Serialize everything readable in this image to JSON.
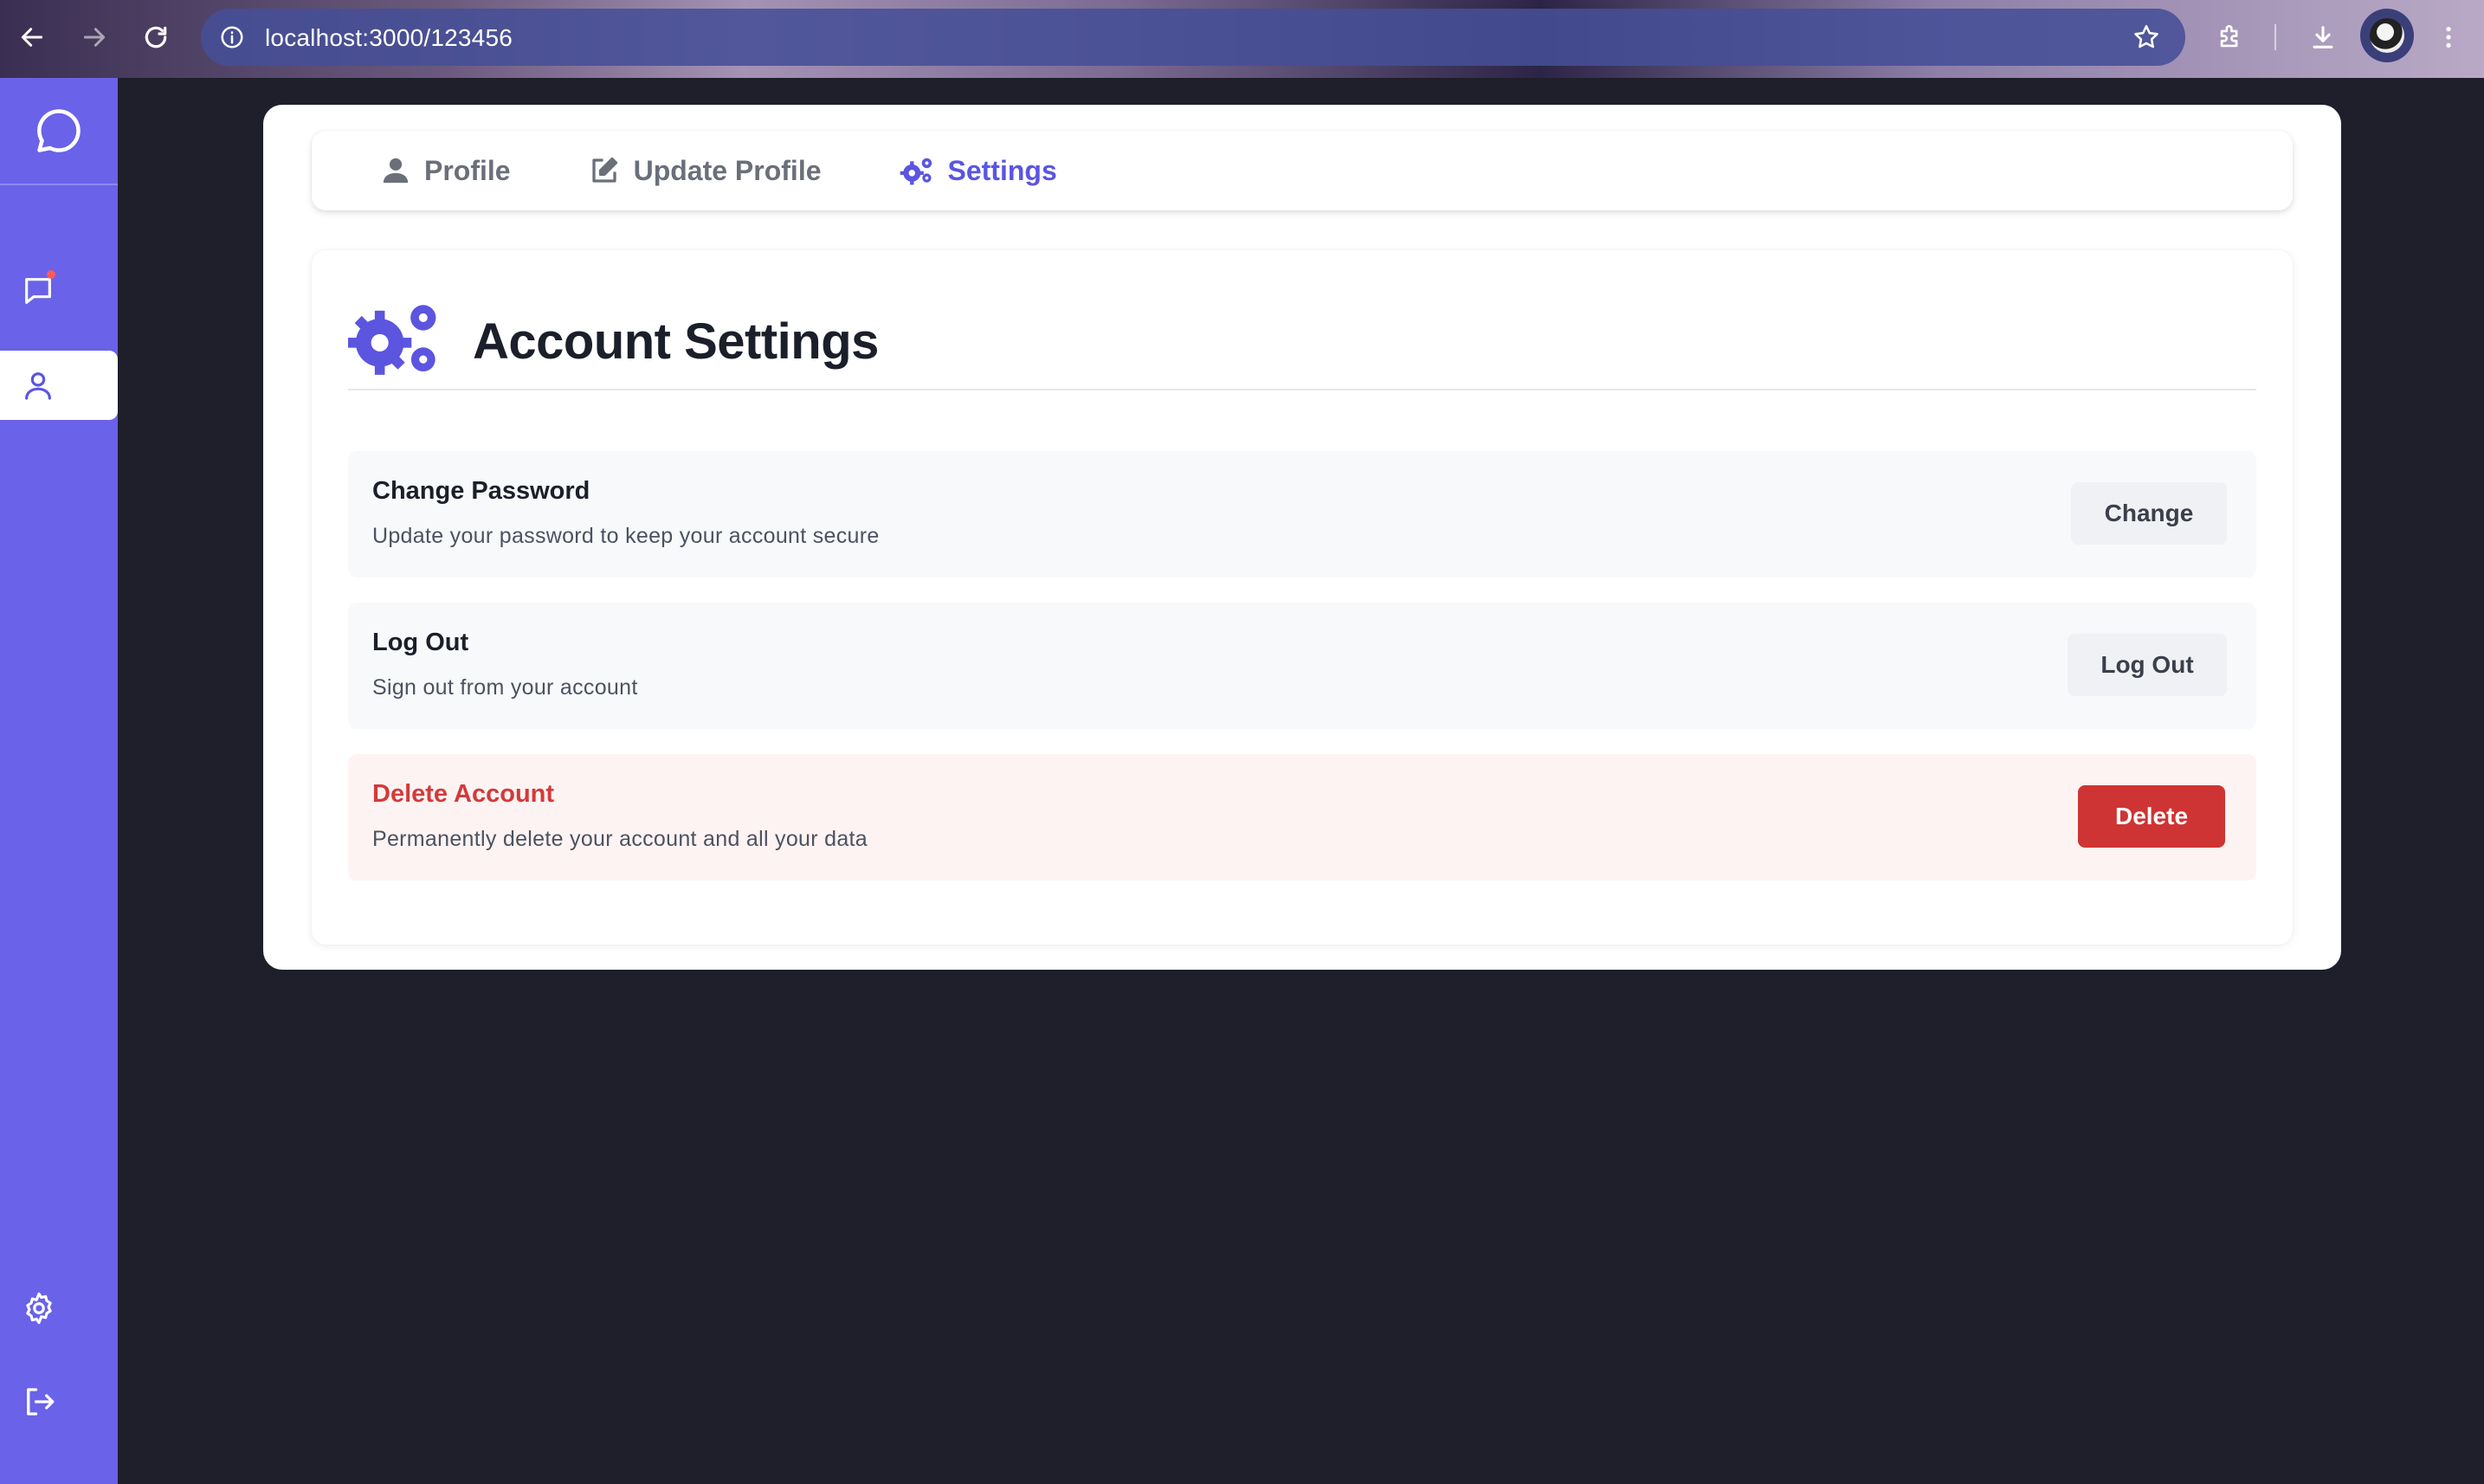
{
  "browser": {
    "url": "localhost:3000/123456"
  },
  "sidebar": {
    "items": [
      {
        "name": "chat",
        "icon": "chat-icon",
        "active": false,
        "has_notification": true
      },
      {
        "name": "profile",
        "icon": "user-icon",
        "active": true,
        "has_notification": false
      }
    ],
    "bottom_items": [
      {
        "name": "settings",
        "icon": "gear-icon"
      },
      {
        "name": "logout",
        "icon": "logout-icon"
      }
    ]
  },
  "tabs": [
    {
      "label": "Profile",
      "icon": "user-icon",
      "active": false
    },
    {
      "label": "Update Profile",
      "icon": "edit-icon",
      "active": false
    },
    {
      "label": "Settings",
      "icon": "gears-icon",
      "active": true
    }
  ],
  "settings": {
    "title": "Account Settings",
    "rows": [
      {
        "title": "Change Password",
        "description": "Update your password to keep your account secure",
        "button": "Change"
      },
      {
        "title": "Log Out",
        "description": "Sign out from your account",
        "button": "Log Out"
      },
      {
        "title": "Delete Account",
        "description": "Permanently delete your account and all your data",
        "button": "Delete"
      }
    ]
  },
  "colors": {
    "accent": "#5b55e0",
    "sidebar": "#6a62e8",
    "danger": "#cf3434",
    "background": "#1e1f2b"
  }
}
